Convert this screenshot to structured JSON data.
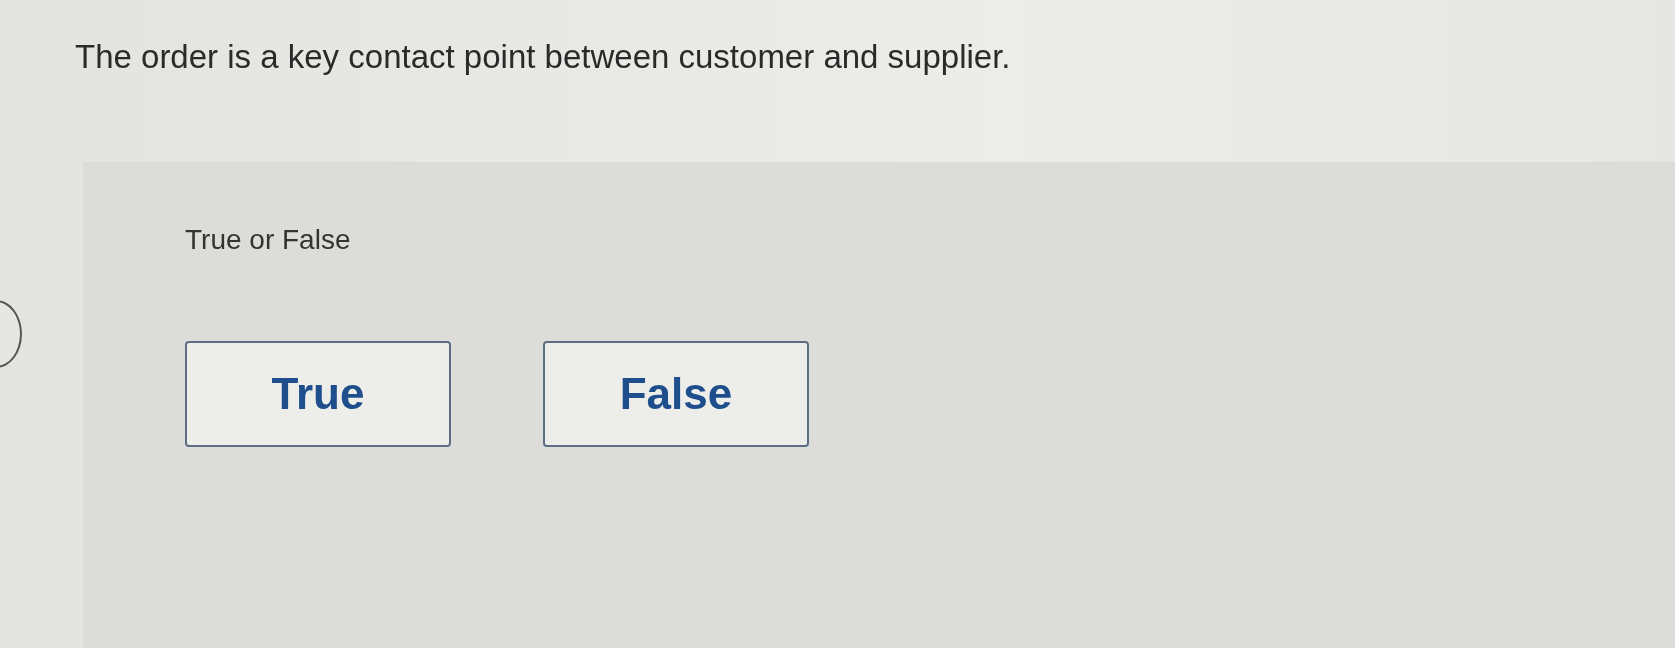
{
  "question": "The order is a key contact point between customer and supplier.",
  "prompt": "True or False",
  "options": [
    {
      "label": "True",
      "selected": false
    },
    {
      "label": "False",
      "selected": false
    }
  ]
}
